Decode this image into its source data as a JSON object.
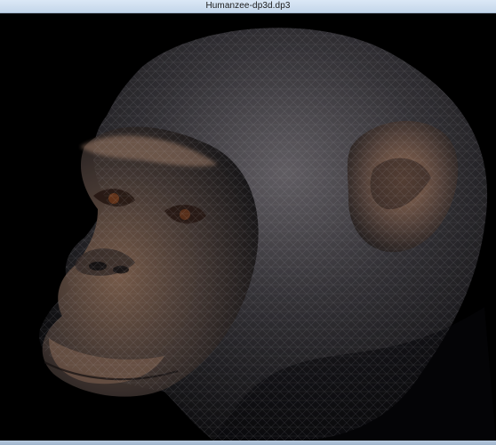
{
  "window": {
    "title": "Humanzee-dp3d.dp3"
  },
  "viewport": {
    "background": "#000000",
    "subject": "chimp-head-wireframe-render"
  },
  "colors": {
    "titlebar": "#c4d6ea",
    "skin_dark": "#2b2a2f",
    "skin_warm": "#7a5a45"
  }
}
